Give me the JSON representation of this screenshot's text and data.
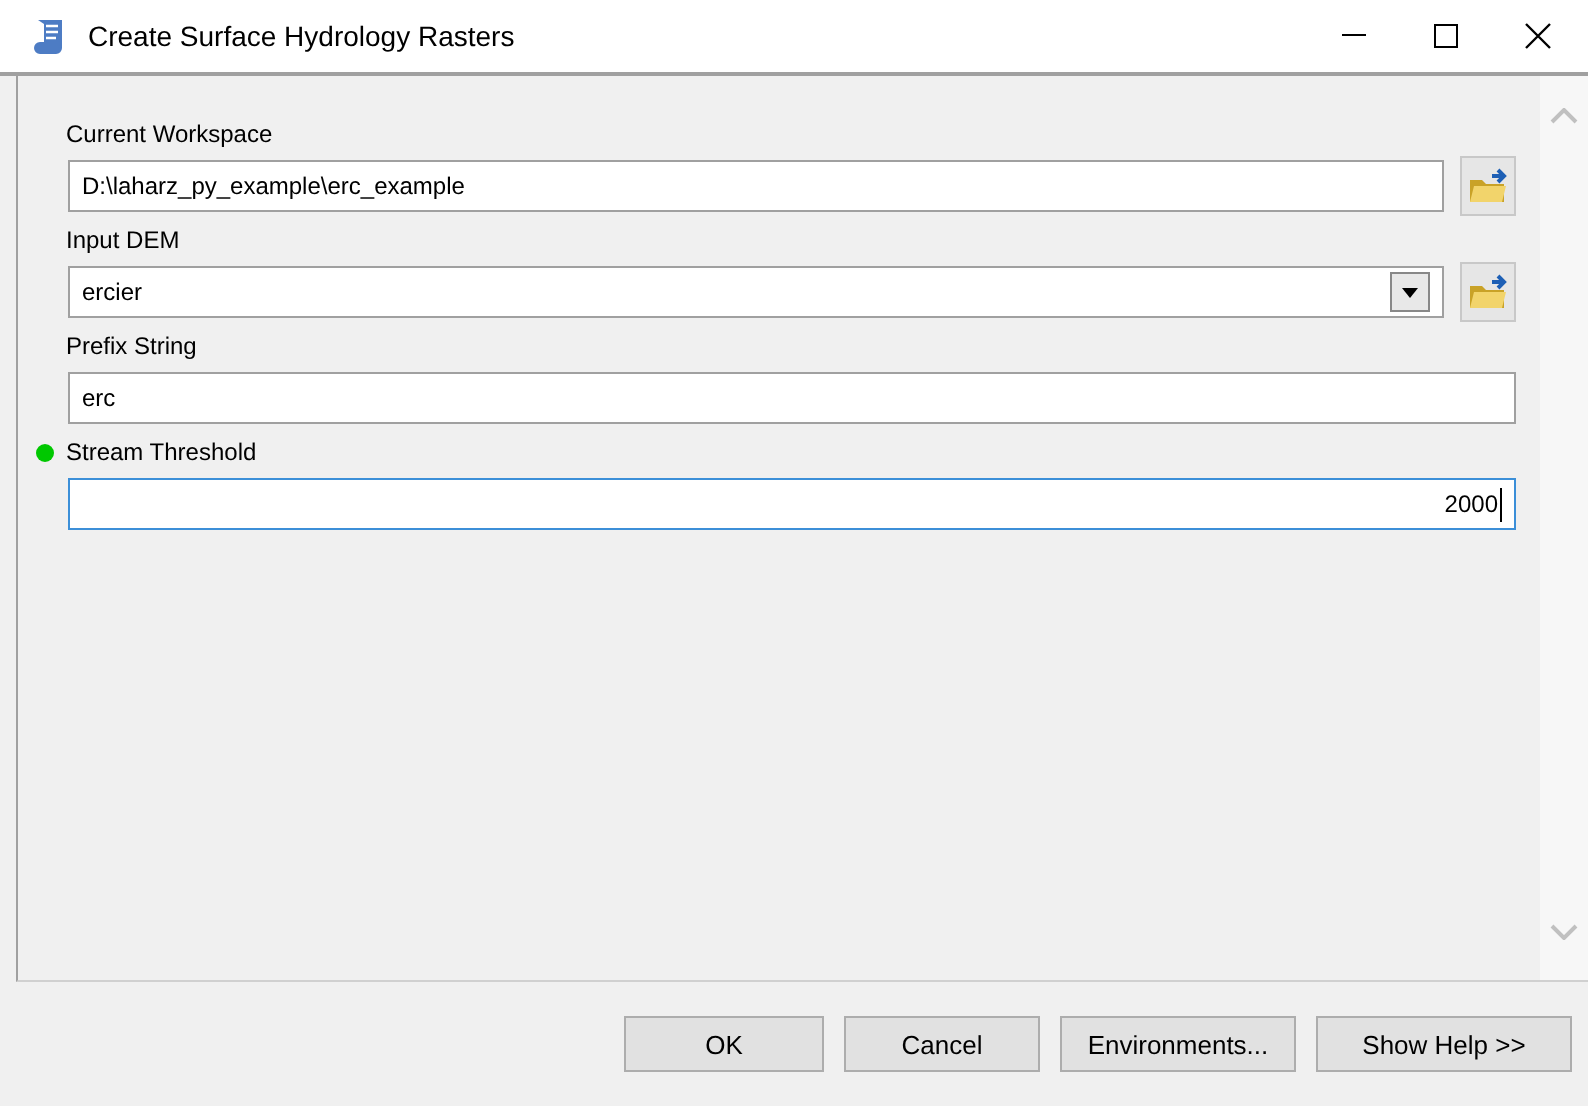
{
  "window": {
    "title": "Create Surface Hydrology Rasters"
  },
  "parameters": [
    {
      "label": "Current Workspace",
      "kind": "text",
      "value": "D:\\laharz_py_example\\erc_example",
      "browse": true,
      "focused": false,
      "marked": false
    },
    {
      "label": "Input DEM",
      "kind": "dropdown",
      "value": "ercier",
      "browse": true,
      "focused": false,
      "marked": false
    },
    {
      "label": "Prefix String",
      "kind": "text",
      "value": "erc",
      "browse": false,
      "focused": false,
      "marked": false
    },
    {
      "label": "Stream Threshold",
      "kind": "number",
      "value": "2000",
      "browse": false,
      "focused": true,
      "marked": true
    }
  ],
  "buttons": [
    "OK",
    "Cancel",
    "Environments...",
    "Show Help >>"
  ]
}
